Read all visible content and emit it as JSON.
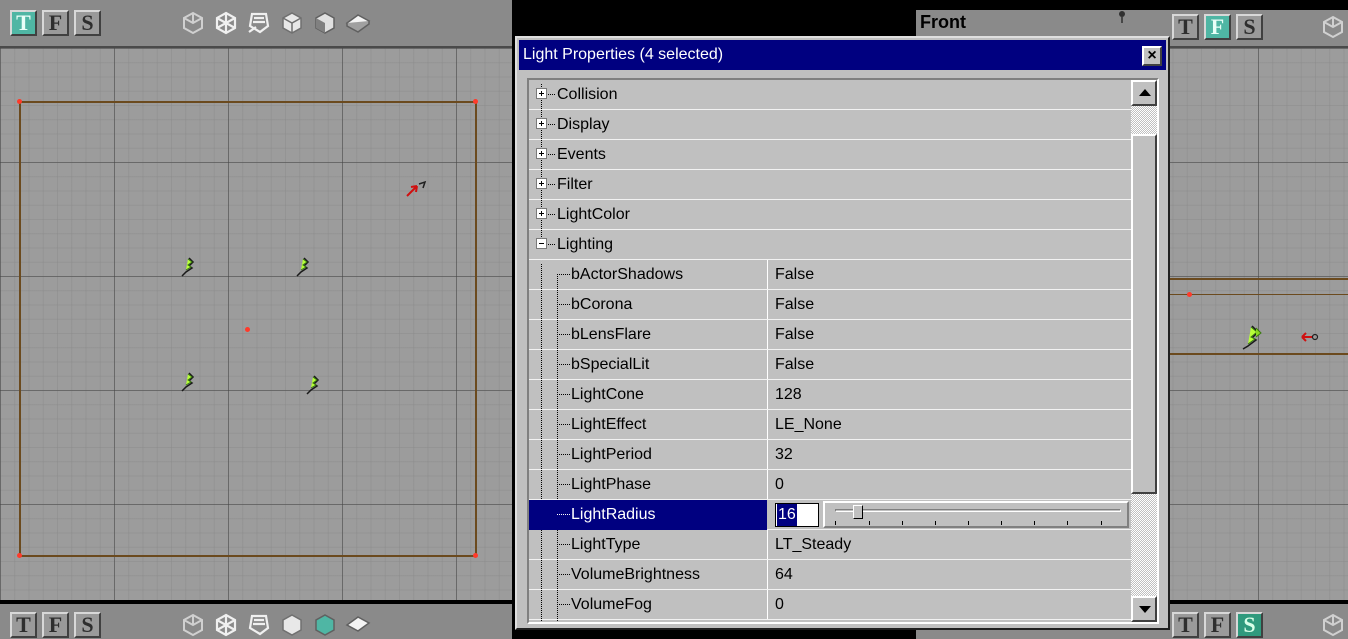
{
  "window": {
    "title": "Light Properties (4 selected)",
    "close_glyph": "×"
  },
  "viewports": {
    "top": {
      "buttons": [
        "T",
        "F",
        "S"
      ],
      "active": "T"
    },
    "front": {
      "label": "Front",
      "buttons": [
        "T",
        "F",
        "S"
      ],
      "active": "F"
    },
    "bottom_left": {
      "buttons": [
        "T",
        "F",
        "S"
      ]
    },
    "bottom_right": {
      "buttons": [
        "T",
        "F",
        "S"
      ],
      "active": "S"
    },
    "view_mode_icons": [
      "wireframe-icon",
      "zone-icon",
      "texture-usage-icon",
      "solid-icon",
      "textured-icon",
      "lighting-icon"
    ]
  },
  "properties": {
    "categories": [
      {
        "name": "Collision",
        "expanded": false
      },
      {
        "name": "Display",
        "expanded": false
      },
      {
        "name": "Events",
        "expanded": false
      },
      {
        "name": "Filter",
        "expanded": false
      },
      {
        "name": "LightColor",
        "expanded": false
      },
      {
        "name": "Lighting",
        "expanded": true
      }
    ],
    "lighting_items": [
      {
        "name": "bActorShadows",
        "value": "False"
      },
      {
        "name": "bCorona",
        "value": "False"
      },
      {
        "name": "bLensFlare",
        "value": "False"
      },
      {
        "name": "bSpecialLit",
        "value": "False"
      },
      {
        "name": "LightCone",
        "value": "128"
      },
      {
        "name": "LightEffect",
        "value": "LE_None"
      },
      {
        "name": "LightPeriod",
        "value": "32"
      },
      {
        "name": "LightPhase",
        "value": "0"
      },
      {
        "name": "LightRadius",
        "value": "16",
        "selected": true
      },
      {
        "name": "LightType",
        "value": "LT_Steady"
      },
      {
        "name": "VolumeBrightness",
        "value": "64"
      },
      {
        "name": "VolumeFog",
        "value": "0"
      }
    ],
    "slider_level": 0.063
  },
  "colors": {
    "selection": "#000080",
    "active_view_button": "#4fb6a4",
    "grid_background": "#9c9c9c",
    "brush_outline": "#6b4a1e",
    "vertex_dot": "#ff3a2a"
  }
}
